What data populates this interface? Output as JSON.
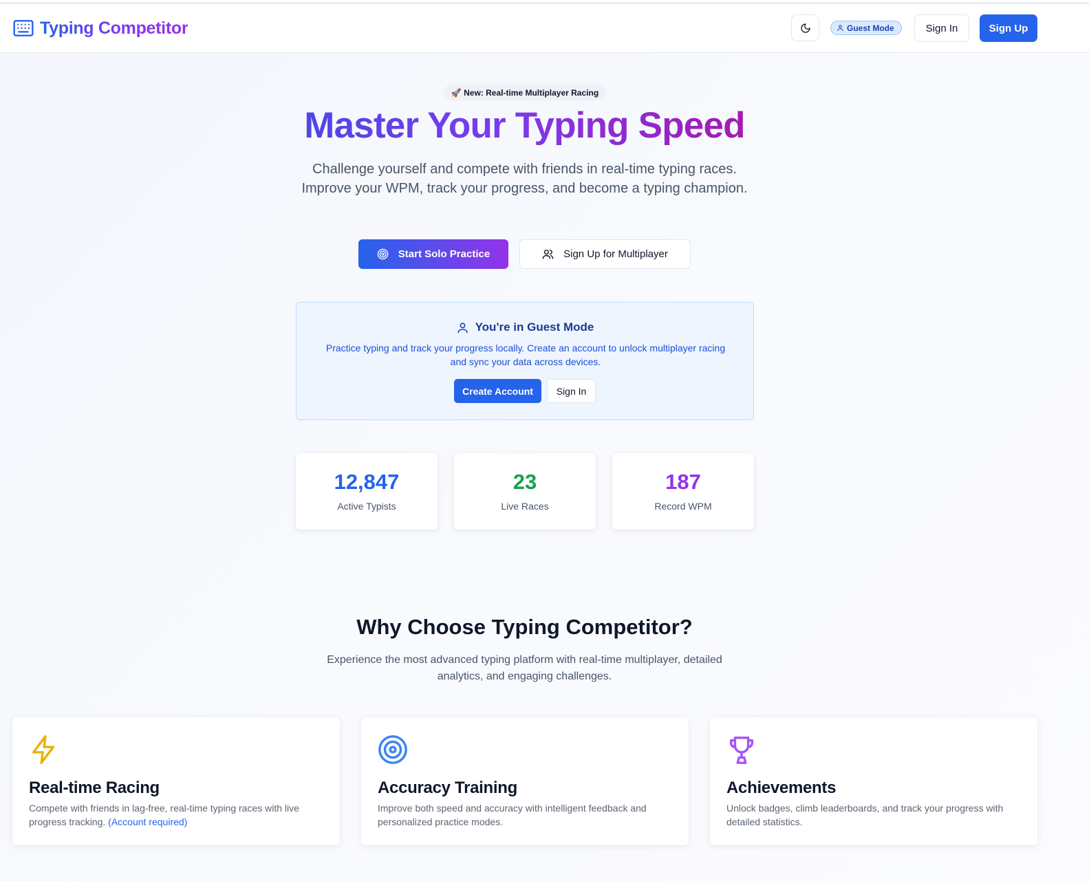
{
  "header": {
    "app_title": "Typing Competitor",
    "logo_icon": "keyboard-icon",
    "theme_icon": "moon-icon",
    "guest_badge": "Guest Mode",
    "sign_in": "Sign In",
    "sign_up": "Sign Up"
  },
  "hero": {
    "announcement": "🚀 New: Real-time Multiplayer Racing",
    "title": "Master Your Typing Speed",
    "subtitle": "Challenge yourself and compete with friends in real-time typing races. Improve your WPM, track your progress, and become a typing champion.",
    "primary_button": "Start Solo Practice",
    "secondary_button": "Sign Up for Multiplayer"
  },
  "guest_card": {
    "title": "You're in Guest Mode",
    "text": "Practice typing and track your progress locally. Create an account to unlock multiplayer racing and sync your data across devices.",
    "create_account": "Create Account",
    "sign_in": "Sign In"
  },
  "stats": [
    {
      "value": "12,847",
      "label": "Active Typists",
      "color": "#2563eb"
    },
    {
      "value": "23",
      "label": "Live Races",
      "color": "#16a34a"
    },
    {
      "value": "187",
      "label": "Record WPM",
      "color": "#9333ea"
    }
  ],
  "why": {
    "title": "Why Choose Typing Competitor?",
    "subtitle": "Experience the most advanced typing platform with real-time multiplayer, detailed analytics, and engaging challenges."
  },
  "features": [
    {
      "icon": "lightning-icon",
      "title": "Real-time Racing",
      "description": "Compete with friends in lag-free, real-time typing races with live progress tracking.",
      "note": "(Account required)",
      "icon_color": "#eab308"
    },
    {
      "icon": "target-icon",
      "title": "Accuracy Training",
      "description": "Improve both speed and accuracy with intelligent feedback and personalized practice modes.",
      "icon_color": "#3b82f6"
    },
    {
      "icon": "trophy-icon",
      "title": "Achievements",
      "description": "Unlock badges, climb leaderboards, and track your progress with detailed statistics.",
      "icon_color": "#a855f7"
    }
  ]
}
